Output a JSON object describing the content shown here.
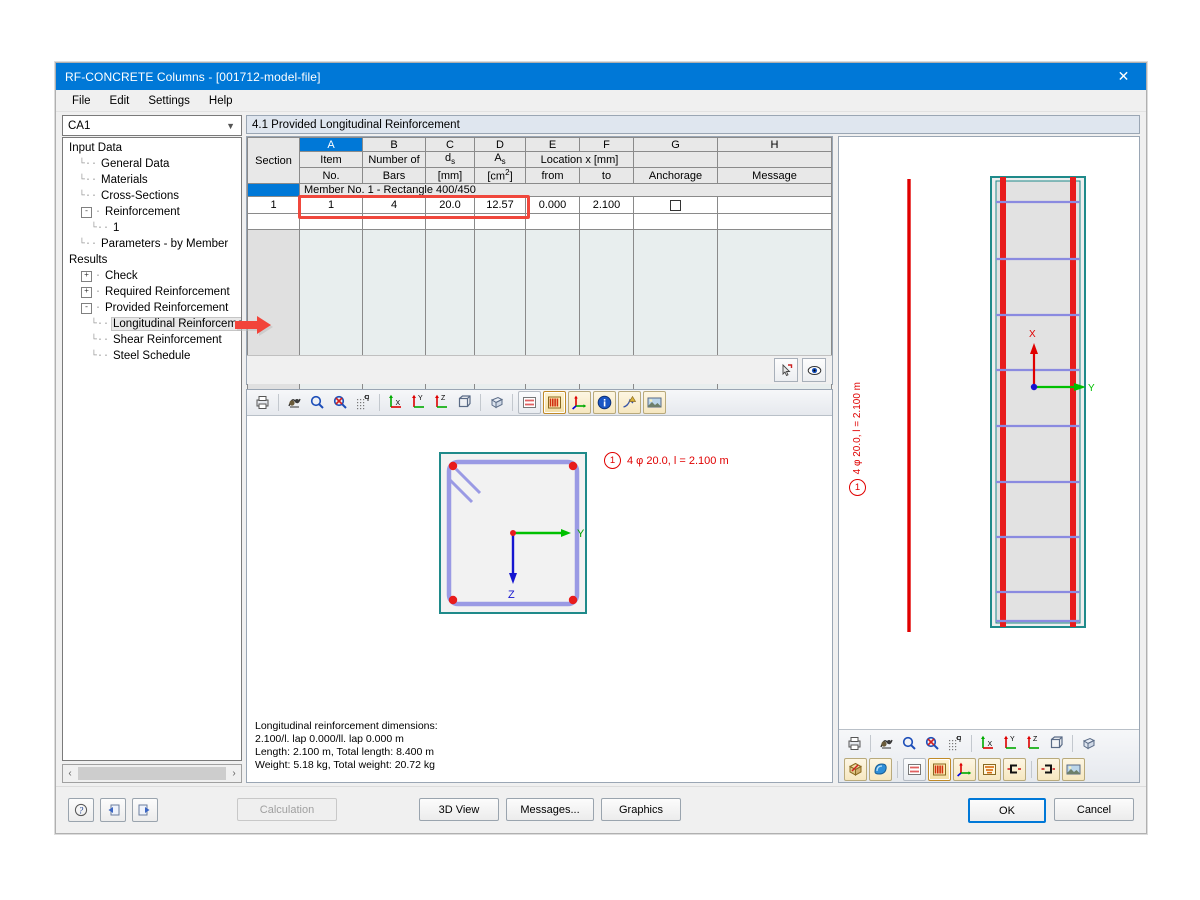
{
  "window": {
    "title": "RF-CONCRETE Columns - [001712-model-file]",
    "close_icon": "close-icon",
    "menu": [
      "File",
      "Edit",
      "Settings",
      "Help"
    ]
  },
  "sidebar": {
    "combo_value": "CA1",
    "chevron": "⌄",
    "scroll_left": "‹",
    "scroll_right": "›",
    "items": [
      {
        "label": "Input Data",
        "indent": 0,
        "expander": "",
        "dots": false
      },
      {
        "label": "General Data",
        "indent": 1,
        "expander": "",
        "dots": true
      },
      {
        "label": "Materials",
        "indent": 1,
        "expander": "",
        "dots": true
      },
      {
        "label": "Cross-Sections",
        "indent": 1,
        "expander": "",
        "dots": true
      },
      {
        "label": "Reinforcement",
        "indent": 1,
        "expander": "-",
        "dots": true
      },
      {
        "label": "1",
        "indent": 2,
        "expander": "",
        "dots": true
      },
      {
        "label": "Parameters - by Member",
        "indent": 1,
        "expander": "",
        "dots": true
      },
      {
        "label": "Results",
        "indent": 0,
        "expander": "",
        "dots": false
      },
      {
        "label": "Check",
        "indent": 1,
        "expander": "+",
        "dots": true
      },
      {
        "label": "Required Reinforcement",
        "indent": 1,
        "expander": "+",
        "dots": true
      },
      {
        "label": "Provided Reinforcement",
        "indent": 1,
        "expander": "-",
        "dots": true
      },
      {
        "label": "Longitudinal Reinforcement",
        "indent": 2,
        "expander": "",
        "dots": true,
        "selected": true
      },
      {
        "label": "Shear Reinforcement",
        "indent": 2,
        "expander": "",
        "dots": true
      },
      {
        "label": "Steel Schedule",
        "indent": 2,
        "expander": "",
        "dots": true
      }
    ]
  },
  "main": {
    "panel_title": "4.1 Provided Longitudinal Reinforcement"
  },
  "table": {
    "column_letters": [
      "",
      "A",
      "B",
      "C",
      "D",
      "E",
      "F",
      "G",
      "H"
    ],
    "headers": [
      {
        "line1": "Section",
        "line2": "",
        "line3": ""
      },
      {
        "line1": "Item",
        "line2": "No.",
        "line3": ""
      },
      {
        "line1": "Number of",
        "line2": "Bars",
        "line3": ""
      },
      {
        "line1": "d",
        "sub1": "s",
        "line2": "[mm]",
        "line3": ""
      },
      {
        "line1": "A",
        "sub1": "s",
        "line2": "[cm",
        "sup2": "2",
        "line2b": "]",
        "line3": ""
      },
      {
        "line1": "Location x [mm]",
        "line2": "from",
        "line3": ""
      },
      {
        "line1": "",
        "line2": "to",
        "line3": ""
      },
      {
        "line1": "",
        "line2": "Anchorage",
        "line3": ""
      },
      {
        "line1": "",
        "line2": "Message",
        "line3": ""
      }
    ],
    "section_row": "Member No. 1 - Rectangle 400/450",
    "rows": [
      {
        "section": "1",
        "item_no": "1",
        "number_of_bars": "4",
        "ds": "20.0",
        "as": "12.57",
        "from": "0.000",
        "to": "2.100",
        "anchorage": "unchecked",
        "message": ""
      }
    ],
    "footer_buttons": [
      {
        "name": "pick-from-graphic-button",
        "icon": "cursor-pick-icon"
      },
      {
        "name": "view-mode-button",
        "icon": "eye-icon"
      }
    ]
  },
  "gfx_toolbar": {
    "buttons": [
      {
        "name": "print-button",
        "icon": "printer-icon"
      },
      {
        "name": "render-button",
        "icon": "render-icon"
      },
      {
        "name": "zoom-in-button",
        "icon": "magnifier-icon"
      },
      {
        "name": "zoom-reset-button",
        "icon": "magnifier-cancel-icon"
      },
      {
        "name": "grid-snap-button",
        "icon": "grid-snap-icon"
      },
      {
        "name": "view-x-button",
        "icon": "axis-x-icon"
      },
      {
        "name": "view-y-button",
        "icon": "axis-y-icon"
      },
      {
        "name": "view-z-button",
        "icon": "axis-z-icon"
      },
      {
        "name": "view-iso-button",
        "icon": "cube-icon"
      },
      {
        "name": "view-perspective-button",
        "icon": "cube-perspective-icon"
      },
      {
        "name": "show-sections-button",
        "icon": "section-lines-icon"
      },
      {
        "name": "show-reinforcement-button",
        "icon": "reinforcement-bars-icon"
      },
      {
        "name": "show-axes-button",
        "icon": "axes-tripod-icon"
      },
      {
        "name": "info-button",
        "icon": "info-icon"
      },
      {
        "name": "show-dimensions-button",
        "icon": "dimension-arrow-icon"
      },
      {
        "name": "background-button",
        "icon": "picture-icon"
      }
    ]
  },
  "section_graphic": {
    "callout_number": "1",
    "callout_text": "4 φ 20.0, l = 2.100 m",
    "axis_y_label": "Y",
    "axis_z_label": "Z"
  },
  "dimensions_text": [
    "Longitudinal reinforcement dimensions:",
    "2.100/l. lap 0.000/ll. lap 0.000 m",
    "Length: 2.100 m, Total length: 8.400 m",
    "Weight: 5.18 kg, Total weight: 20.72 kg"
  ],
  "view3d": {
    "callout_number": "1",
    "callout_text": "4 φ 20.0, l = 2.100 m",
    "axis_x_label": "X",
    "axis_y_label": "Y",
    "toolbar_row1": [
      {
        "name": "print-button",
        "icon": "printer-icon"
      },
      {
        "name": "render-button",
        "icon": "render-icon"
      },
      {
        "name": "zoom-in-button",
        "icon": "magnifier-icon"
      },
      {
        "name": "zoom-reset-button",
        "icon": "magnifier-cancel-icon"
      },
      {
        "name": "grid-snap-button",
        "icon": "grid-snap-icon"
      },
      {
        "name": "view-x-button",
        "icon": "axis-x-icon"
      },
      {
        "name": "view-y-button",
        "icon": "axis-y-icon"
      },
      {
        "name": "view-z-button",
        "icon": "axis-z-icon"
      },
      {
        "name": "view-iso-button",
        "icon": "cube-icon"
      },
      {
        "name": "view-perspective-button",
        "icon": "cube-perspective-icon"
      }
    ],
    "toolbar_row2": [
      {
        "name": "solid-model-button",
        "icon": "solid-cube-icon"
      },
      {
        "name": "shaded-model-button",
        "icon": "shaded-sphere-icon"
      },
      {
        "name": "show-sections-button",
        "icon": "section-lines-icon"
      },
      {
        "name": "show-reinforcement-button",
        "icon": "reinforcement-bars-icon"
      },
      {
        "name": "show-axes-button",
        "icon": "axes-tripod-icon"
      },
      {
        "name": "show-stirrups-button",
        "icon": "stirrups-icon"
      },
      {
        "name": "show-anchorage-left-button",
        "icon": "anchorage-left-icon"
      },
      {
        "name": "show-anchorage-right-button",
        "icon": "anchorage-right-icon"
      },
      {
        "name": "background-button",
        "icon": "picture-icon"
      }
    ]
  },
  "bottombar": {
    "left_icons": [
      {
        "name": "help-button",
        "icon": "question-icon"
      },
      {
        "name": "prev-window-button",
        "icon": "arrow-left-window-icon"
      },
      {
        "name": "next-window-button",
        "icon": "arrow-right-window-icon"
      }
    ],
    "calculation": "Calculation",
    "view3d": "3D View",
    "messages": "Messages...",
    "graphics": "Graphics",
    "ok": "OK",
    "cancel": "Cancel"
  },
  "annotation": {
    "arrow_color": "#f2443a",
    "arrow_target": "sidebar-item-longitudinal-reinforcement"
  },
  "colors": {
    "accent": "#0078d7",
    "highlight_box": "#f0473c",
    "panel_title_bg": "#dfe6ef",
    "rebar_red": "#e00000",
    "stirrup_blue": "#8a8ae0",
    "concrete_teal": "#1f8a8a"
  }
}
